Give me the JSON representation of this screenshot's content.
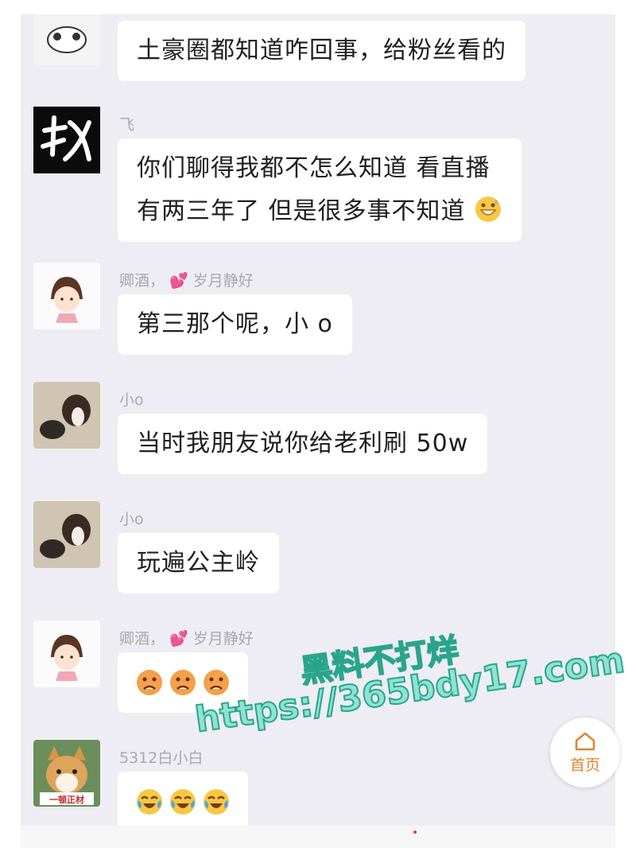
{
  "messages": [
    {
      "avatar": "panda-avatar",
      "sender": "",
      "lines": [
        "土豪圈都知道咋回事，给粉丝看的"
      ]
    },
    {
      "avatar": "calligraphy-zhao-avatar",
      "sender": "飞",
      "lines": [
        "你们聊得我都不怎么知道  看直播",
        "有两三年了  但是很多事不知道"
      ],
      "trailing_emoji": "grinning-sweat-emoji"
    },
    {
      "avatar": "cartoon-girl-avatar",
      "sender": "卿酒，",
      "sender_suffix": "岁月静好",
      "lines": [
        "第三那个呢，小 o"
      ]
    },
    {
      "avatar": "dog-avatar",
      "sender": "小o",
      "lines": [
        "当时我朋友说你给老利刷 50w"
      ]
    },
    {
      "avatar": "dog-avatar",
      "sender": "小o",
      "lines": [
        "玩遍公主岭"
      ]
    },
    {
      "avatar": "cartoon-girl-avatar",
      "sender": "卿酒，",
      "sender_suffix": "岁月静好",
      "emojis": [
        "frowning-emoji",
        "frowning-emoji",
        "frowning-emoji"
      ]
    },
    {
      "avatar": "shiba-avatar",
      "sender": "5312白小白",
      "avatar_text": "一顿正材",
      "emojis": [
        "crying-laughing-emoji",
        "crying-laughing-emoji",
        "crying-laughing-emoji"
      ]
    }
  ],
  "watermark": {
    "line1": "黑料不打烊",
    "line2": "https://365bdy17.com"
  },
  "home_button": {
    "label": "首页",
    "icon": "home-icon"
  },
  "colors": {
    "chat_bg": "#ededf3",
    "bubble": "#ffffff",
    "sender": "#a8a8ad",
    "home_accent": "#e0862c",
    "watermark": "#8fe3d2"
  }
}
